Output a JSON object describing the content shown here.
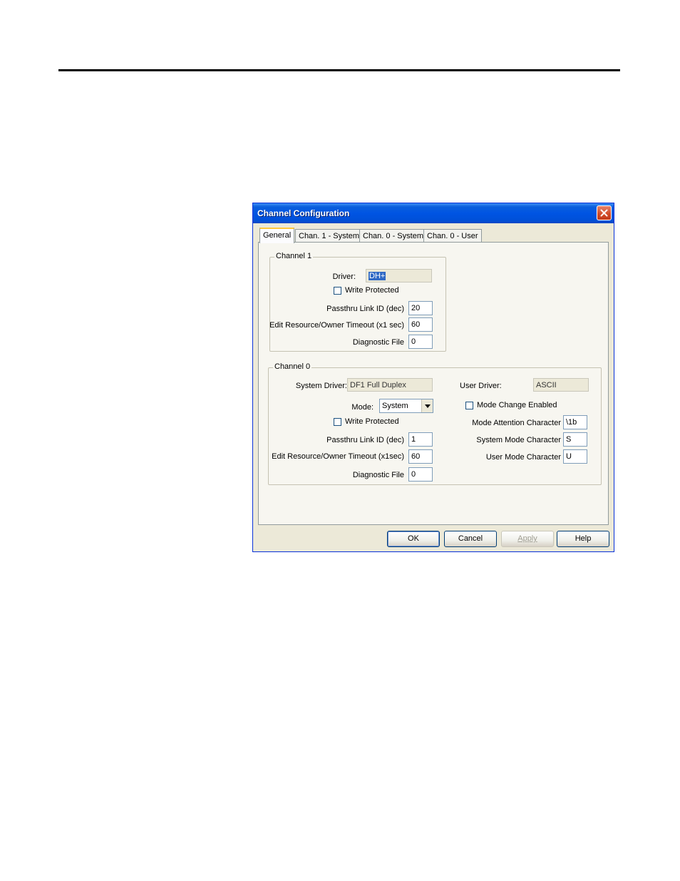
{
  "dialog": {
    "title": "Channel Configuration",
    "tabs": [
      {
        "label": "General",
        "active": true
      },
      {
        "label": "Chan. 1 - System",
        "active": false
      },
      {
        "label": "Chan. 0 - System",
        "active": false
      },
      {
        "label": "Chan. 0 - User",
        "active": false
      }
    ],
    "channel1": {
      "legend": "Channel 1",
      "driver_label": "Driver:",
      "driver_value": "DH+",
      "write_protected_label": "Write Protected",
      "write_protected_checked": false,
      "passthru_label": "Passthru Link ID (dec)",
      "passthru_value": "20",
      "timeout_label": "Edit Resource/Owner Timeout (x1 sec)",
      "timeout_value": "60",
      "diagnostic_label": "Diagnostic File",
      "diagnostic_value": "0"
    },
    "channel0": {
      "legend": "Channel 0",
      "system_driver_label": "System Driver:",
      "system_driver_value": "DF1 Full Duplex",
      "user_driver_label": "User Driver:",
      "user_driver_value": "ASCII",
      "mode_label": "Mode:",
      "mode_value": "System",
      "mode_change_label": "Mode Change Enabled",
      "mode_change_checked": false,
      "write_protected_label": "Write Protected",
      "write_protected_checked": false,
      "attention_label": "Mode Attention Character",
      "attention_value": "\\1b",
      "passthru_label": "Passthru Link ID (dec)",
      "passthru_value": "1",
      "system_mode_char_label": "System Mode Character",
      "system_mode_char_value": "S",
      "timeout_label": "Edit Resource/Owner Timeout (x1sec)",
      "timeout_value": "60",
      "user_mode_char_label": "User Mode Character",
      "user_mode_char_value": "U",
      "diagnostic_label": "Diagnostic File",
      "diagnostic_value": "0"
    },
    "buttons": {
      "ok": "OK",
      "cancel": "Cancel",
      "apply": "Apply",
      "help": "Help"
    },
    "icons": {
      "close": "close-icon",
      "dropdown": "chevron-down-icon"
    },
    "colors": {
      "titlebar": "#0054e3",
      "close_button": "#d04a25",
      "face": "#ece9d8",
      "active_tab_accent": "#ffc83c"
    }
  }
}
